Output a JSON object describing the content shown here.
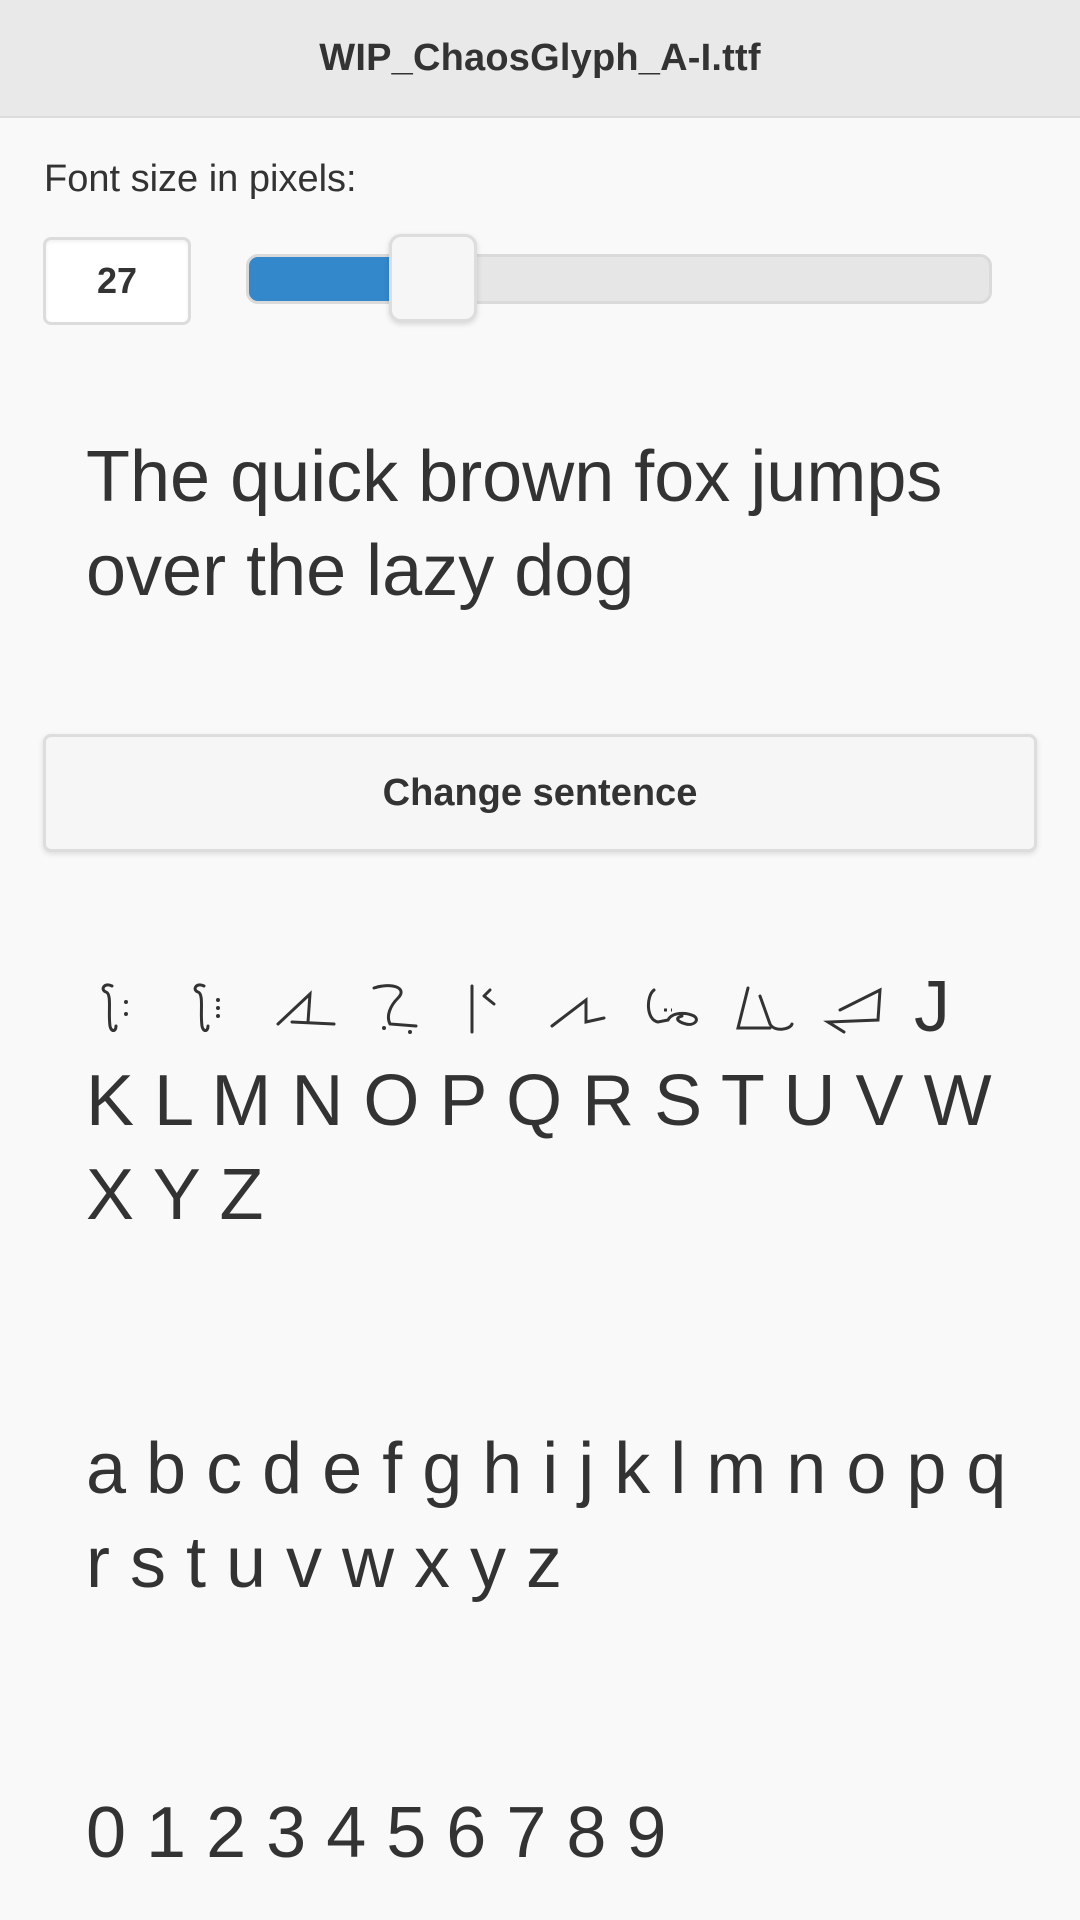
{
  "header": {
    "title": "WIP_ChaosGlyph_A-I.ttf"
  },
  "font_size": {
    "label": "Font size in pixels:",
    "value": "27",
    "slider_fraction": 0.25
  },
  "sample": {
    "text": "The quick brown fox jumps over the lazy dog",
    "change_button_label": "Change sentence"
  },
  "character_set": {
    "glyphs_a_to_i": [
      "A",
      "B",
      "C",
      "D",
      "E",
      "F",
      "G",
      "H",
      "I"
    ],
    "upper_j": "J",
    "uppercase_rest": "K L M N O P Q R S T U V W X Y Z",
    "lowercase": "a b c d e f g h i j k l m n o p q r s t u v w x y z",
    "digits": "0 1 2 3 4 5 6 7 8 9"
  },
  "colors": {
    "accent": "#3388cc",
    "header_bg": "#e9e9e9",
    "page_bg": "#f9f9f9",
    "text": "#333333"
  }
}
